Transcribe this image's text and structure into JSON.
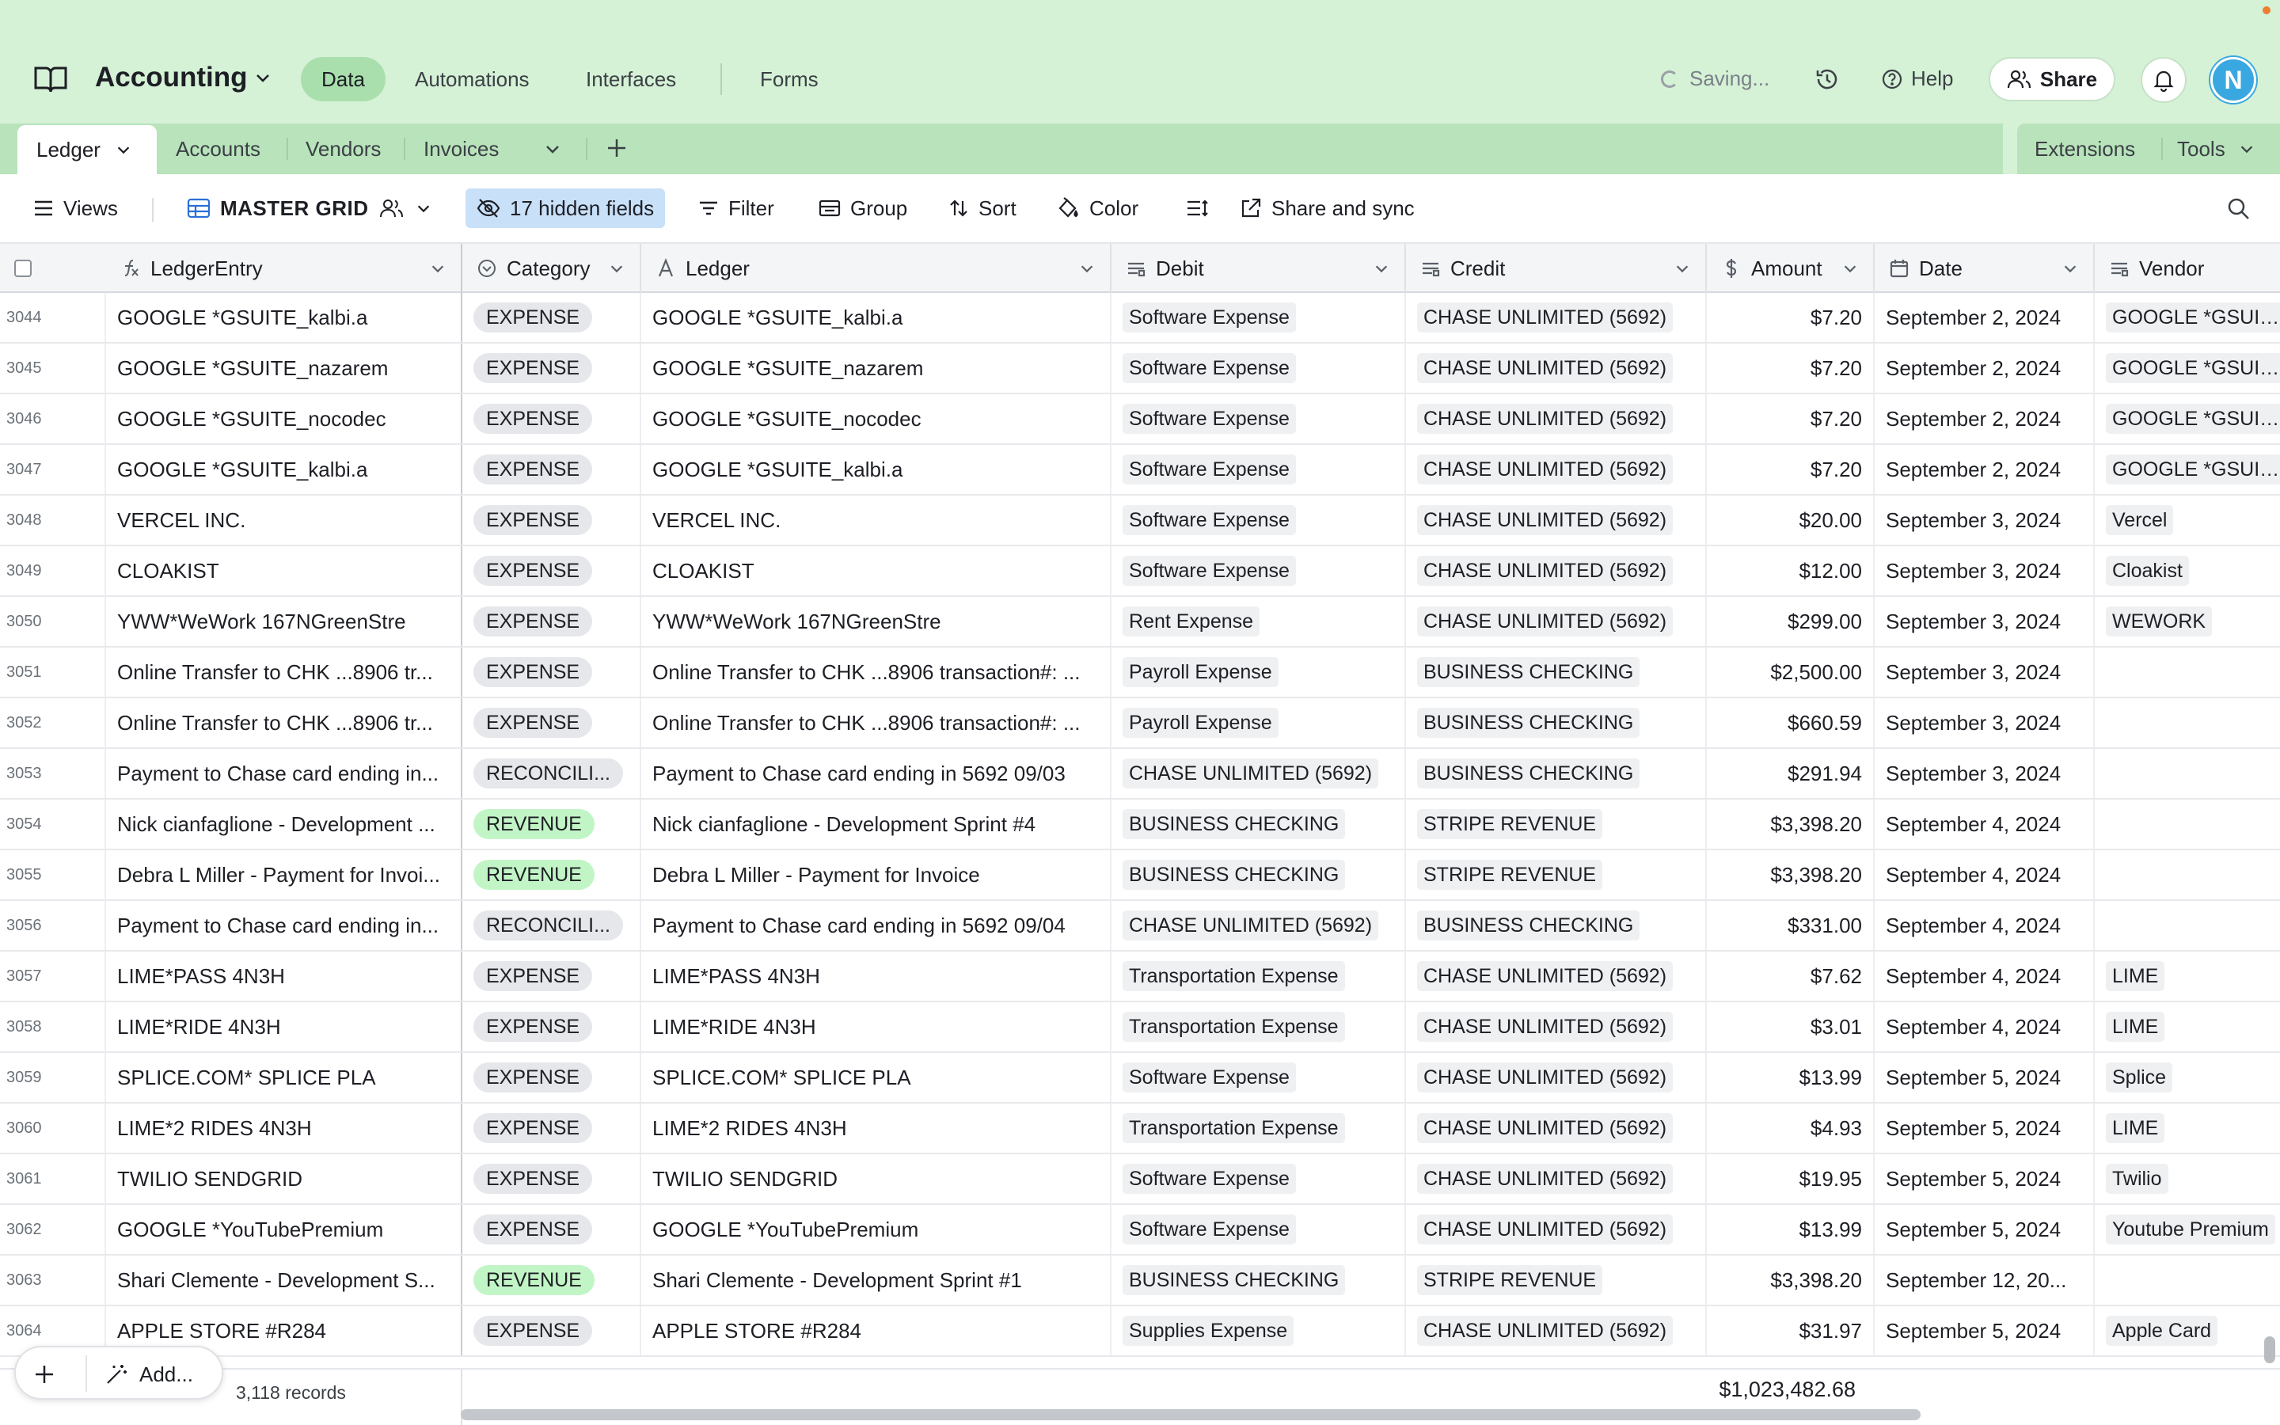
{
  "app": {
    "base_name": "Accounting",
    "nav": [
      "Data",
      "Automations",
      "Interfaces",
      "Forms"
    ],
    "status": "Saving...",
    "help": "Help",
    "share": "Share",
    "avatar_initial": "N",
    "accent_color": "#d5f1d6"
  },
  "tabs": {
    "active": "Ledger",
    "others": [
      "Accounts",
      "Vendors",
      "Invoices"
    ],
    "extensions": "Extensions",
    "tools": "Tools"
  },
  "viewbar": {
    "views": "Views",
    "grid_name": "MASTER GRID",
    "hidden_fields": "17 hidden fields",
    "filter": "Filter",
    "group": "Group",
    "sort": "Sort",
    "color": "Color",
    "share_sync": "Share and sync"
  },
  "columns": {
    "ledger_entry": "LedgerEntry",
    "category": "Category",
    "ledger": "Ledger",
    "debit": "Debit",
    "credit": "Credit",
    "amount": "Amount",
    "date": "Date",
    "vendor": "Vendor"
  },
  "rows": [
    {
      "num": "3044",
      "entry": "GOOGLE *GSUITE_kalbi.a",
      "category": "EXPENSE",
      "ledger": "GOOGLE *GSUITE_kalbi.a",
      "debit": "Software Expense",
      "credit": "CHASE UNLIMITED (5692)",
      "amount": "$7.20",
      "date": "September 2, 2024",
      "vendor": "GOOGLE *GSUITE"
    },
    {
      "num": "3045",
      "entry": "GOOGLE *GSUITE_nazarem",
      "category": "EXPENSE",
      "ledger": "GOOGLE *GSUITE_nazarem",
      "debit": "Software Expense",
      "credit": "CHASE UNLIMITED (5692)",
      "amount": "$7.20",
      "date": "September 2, 2024",
      "vendor": "GOOGLE *GSUITE"
    },
    {
      "num": "3046",
      "entry": "GOOGLE *GSUITE_nocodec",
      "category": "EXPENSE",
      "ledger": "GOOGLE *GSUITE_nocodec",
      "debit": "Software Expense",
      "credit": "CHASE UNLIMITED (5692)",
      "amount": "$7.20",
      "date": "September 2, 2024",
      "vendor": "GOOGLE *GSUITE"
    },
    {
      "num": "3047",
      "entry": "GOOGLE *GSUITE_kalbi.a",
      "category": "EXPENSE",
      "ledger": "GOOGLE *GSUITE_kalbi.a",
      "debit": "Software Expense",
      "credit": "CHASE UNLIMITED (5692)",
      "amount": "$7.20",
      "date": "September 2, 2024",
      "vendor": "GOOGLE *GSUITE"
    },
    {
      "num": "3048",
      "entry": "VERCEL INC.",
      "category": "EXPENSE",
      "ledger": "VERCEL INC.",
      "debit": "Software Expense",
      "credit": "CHASE UNLIMITED (5692)",
      "amount": "$20.00",
      "date": "September 3, 2024",
      "vendor": "Vercel"
    },
    {
      "num": "3049",
      "entry": "CLOAKIST",
      "category": "EXPENSE",
      "ledger": "CLOAKIST",
      "debit": "Software Expense",
      "credit": "CHASE UNLIMITED (5692)",
      "amount": "$12.00",
      "date": "September 3, 2024",
      "vendor": "Cloakist"
    },
    {
      "num": "3050",
      "entry": "YWW*WeWork 167NGreenStre",
      "category": "EXPENSE",
      "ledger": "YWW*WeWork 167NGreenStre",
      "debit": "Rent Expense",
      "credit": "CHASE UNLIMITED (5692)",
      "amount": "$299.00",
      "date": "September 3, 2024",
      "vendor": "WEWORK"
    },
    {
      "num": "3051",
      "entry": "Online Transfer to CHK ...8906 tr...",
      "category": "EXPENSE",
      "ledger": "Online Transfer to CHK ...8906 transaction#: ...",
      "debit": "Payroll Expense",
      "credit": "BUSINESS CHECKING",
      "amount": "$2,500.00",
      "date": "September 3, 2024",
      "vendor": ""
    },
    {
      "num": "3052",
      "entry": "Online Transfer to CHK ...8906 tr...",
      "category": "EXPENSE",
      "ledger": "Online Transfer to CHK ...8906 transaction#: ...",
      "debit": "Payroll Expense",
      "credit": "BUSINESS CHECKING",
      "amount": "$660.59",
      "date": "September 3, 2024",
      "vendor": ""
    },
    {
      "num": "3053",
      "entry": "Payment to Chase card ending in...",
      "category": "RECONCILI...",
      "ledger": "Payment to Chase card ending in 5692 09/03",
      "debit": "CHASE UNLIMITED (5692)",
      "credit": "BUSINESS CHECKING",
      "amount": "$291.94",
      "date": "September 3, 2024",
      "vendor": ""
    },
    {
      "num": "3054",
      "entry": "Nick cianfaglione - Development ...",
      "category": "REVENUE",
      "ledger": "Nick cianfaglione - Development Sprint #4",
      "debit": "BUSINESS CHECKING",
      "credit": "STRIPE REVENUE",
      "amount": "$3,398.20",
      "date": "September 4, 2024",
      "vendor": ""
    },
    {
      "num": "3055",
      "entry": "Debra L Miller - Payment for Invoi...",
      "category": "REVENUE",
      "ledger": "Debra L Miller - Payment for Invoice",
      "debit": "BUSINESS CHECKING",
      "credit": "STRIPE REVENUE",
      "amount": "$3,398.20",
      "date": "September 4, 2024",
      "vendor": ""
    },
    {
      "num": "3056",
      "entry": "Payment to Chase card ending in...",
      "category": "RECONCILI...",
      "ledger": "Payment to Chase card ending in 5692 09/04",
      "debit": "CHASE UNLIMITED (5692)",
      "credit": "BUSINESS CHECKING",
      "amount": "$331.00",
      "date": "September 4, 2024",
      "vendor": ""
    },
    {
      "num": "3057",
      "entry": "LIME*PASS 4N3H",
      "category": "EXPENSE",
      "ledger": "LIME*PASS 4N3H",
      "debit": "Transportation Expense",
      "credit": "CHASE UNLIMITED (5692)",
      "amount": "$7.62",
      "date": "September 4, 2024",
      "vendor": "LIME"
    },
    {
      "num": "3058",
      "entry": "LIME*RIDE 4N3H",
      "category": "EXPENSE",
      "ledger": "LIME*RIDE 4N3H",
      "debit": "Transportation Expense",
      "credit": "CHASE UNLIMITED (5692)",
      "amount": "$3.01",
      "date": "September 4, 2024",
      "vendor": "LIME"
    },
    {
      "num": "3059",
      "entry": "SPLICE.COM* SPLICE PLA",
      "category": "EXPENSE",
      "ledger": "SPLICE.COM* SPLICE PLA",
      "debit": "Software Expense",
      "credit": "CHASE UNLIMITED (5692)",
      "amount": "$13.99",
      "date": "September 5, 2024",
      "vendor": "Splice"
    },
    {
      "num": "3060",
      "entry": "LIME*2 RIDES 4N3H",
      "category": "EXPENSE",
      "ledger": "LIME*2 RIDES 4N3H",
      "debit": "Transportation Expense",
      "credit": "CHASE UNLIMITED (5692)",
      "amount": "$4.93",
      "date": "September 5, 2024",
      "vendor": "LIME"
    },
    {
      "num": "3061",
      "entry": "TWILIO SENDGRID",
      "category": "EXPENSE",
      "ledger": "TWILIO SENDGRID",
      "debit": "Software Expense",
      "credit": "CHASE UNLIMITED (5692)",
      "amount": "$19.95",
      "date": "September 5, 2024",
      "vendor": "Twilio"
    },
    {
      "num": "3062",
      "entry": "GOOGLE *YouTubePremium",
      "category": "EXPENSE",
      "ledger": "GOOGLE *YouTubePremium",
      "debit": "Software Expense",
      "credit": "CHASE UNLIMITED (5692)",
      "amount": "$13.99",
      "date": "September 5, 2024",
      "vendor": "Youtube Premium"
    },
    {
      "num": "3063",
      "entry": "Shari Clemente - Development S...",
      "category": "REVENUE",
      "ledger": "Shari Clemente - Development Sprint #1",
      "debit": "BUSINESS CHECKING",
      "credit": "STRIPE REVENUE",
      "amount": "$3,398.20",
      "date": "September 12, 20...",
      "vendor": ""
    },
    {
      "num": "3064",
      "entry": "APPLE STORE #R284",
      "category": "EXPENSE",
      "ledger": "APPLE STORE #R284",
      "debit": "Supplies Expense",
      "credit": "CHASE UNLIMITED (5692)",
      "amount": "$31.97",
      "date": "September 5, 2024",
      "vendor": "Apple Card"
    }
  ],
  "footer": {
    "add_label": "Add...",
    "records": "3,118 records",
    "sum": "$1,023,482.68"
  }
}
